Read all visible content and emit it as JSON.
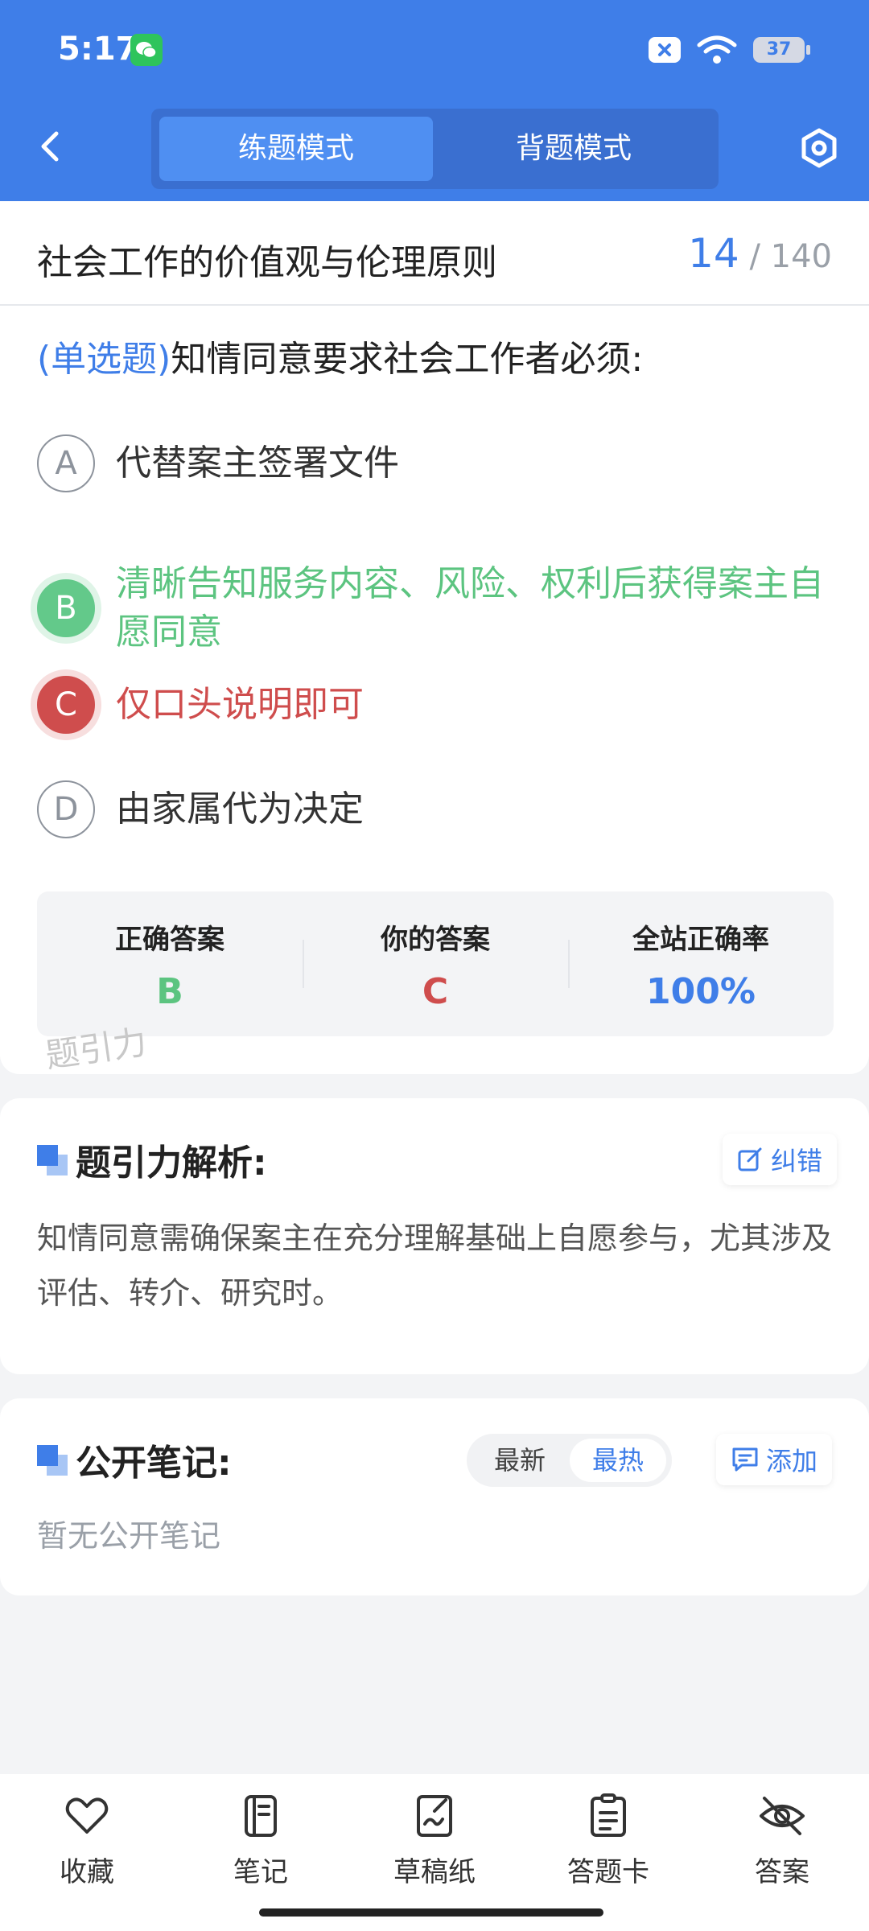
{
  "status_bar": {
    "time": "5:17",
    "battery": "37",
    "icons": [
      "wechat-icon",
      "x-icon",
      "wifi-icon",
      "battery-icon"
    ]
  },
  "header": {
    "mode_tabs": [
      {
        "label": "练题模式",
        "active": true
      },
      {
        "label": "背题模式",
        "active": false
      }
    ]
  },
  "question": {
    "chapter": "社会工作的价值观与伦理原则",
    "current_index": "14",
    "separator": "/",
    "total": "140",
    "type_label": "(单选题)",
    "text": "知情同意要求社会工作者必须:",
    "options": [
      {
        "letter": "A",
        "text": "代替案主签署文件",
        "state": "normal"
      },
      {
        "letter": "B",
        "text": "清晰告知服务内容、风险、权利后获得案主自愿同意",
        "state": "correct"
      },
      {
        "letter": "C",
        "text": "仅口头说明即可",
        "state": "wrong"
      },
      {
        "letter": "D",
        "text": "由家属代为决定",
        "state": "normal"
      }
    ]
  },
  "answer_summary": {
    "correct_label": "正确答案",
    "correct_value": "B",
    "yours_label": "你的答案",
    "yours_value": "C",
    "rate_label": "全站正确率",
    "rate_value": "100%"
  },
  "watermark": "题引力",
  "analysis": {
    "title": "题引力解析:",
    "report_button": "纠错",
    "text": "知情同意需确保案主在充分理解基础上自愿参与，尤其涉及评估、转介、研究时。"
  },
  "notes": {
    "title": "公开笔记:",
    "sort_newest": "最新",
    "sort_hottest": "最热",
    "add_button": "添加",
    "empty_text": "暂无公开笔记"
  },
  "bottom_bar": {
    "items": [
      {
        "label": "收藏",
        "icon": "heart-icon"
      },
      {
        "label": "笔记",
        "icon": "notebook-icon"
      },
      {
        "label": "草稿纸",
        "icon": "draft-icon"
      },
      {
        "label": "答题卡",
        "icon": "answer-card-icon"
      },
      {
        "label": "答案",
        "icon": "eye-off-icon"
      }
    ]
  },
  "colors": {
    "primary": "#3f7ee8",
    "correct": "#5cc480",
    "wrong": "#cf4d4d"
  }
}
